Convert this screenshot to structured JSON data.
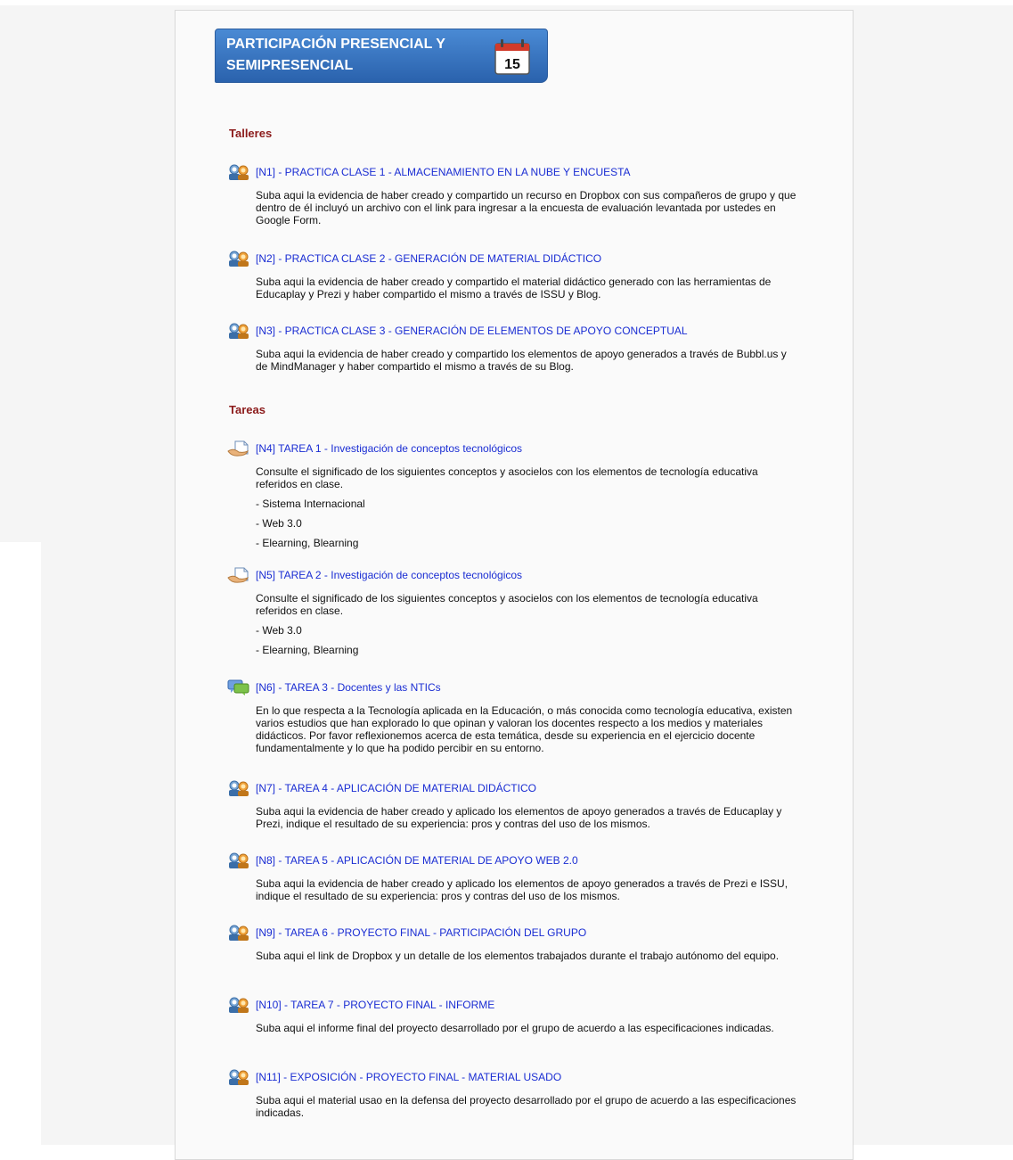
{
  "banner": {
    "title": "PARTICIPACIÓN PRESENCIAL Y SEMIPRESENCIAL",
    "calendar_day": "15"
  },
  "sections": {
    "talleres": "Talleres",
    "tareas": "Tareas"
  },
  "activities": [
    {
      "icon": "workshop-icon",
      "title": "[N1] - PRACTICA CLASE 1 - ALMACENAMIENTO EN LA NUBE Y ENCUESTA",
      "desc": "Suba aqui la evidencia de haber creado y compartido un recurso en Dropbox con sus compañeros de grupo y que dentro de él incluyó un archivo con el link para ingresar a la encuesta de evaluación levantada por ustedes en Google Form.",
      "items": []
    },
    {
      "icon": "workshop-icon",
      "title": "[N2] - PRACTICA CLASE 2 - GENERACIÓN DE MATERIAL DIDÁCTICO",
      "desc": "Suba aqui la evidencia de haber creado y compartido el material didáctico generado con las herramientas de Educaplay y Prezi y haber compartido el mismo a través de ISSU y Blog.",
      "items": []
    },
    {
      "icon": "workshop-icon",
      "title": "[N3] - PRACTICA CLASE 3 - GENERACIÓN DE ELEMENTOS DE APOYO CONCEPTUAL",
      "desc": "Suba aqui la evidencia de haber creado y compartido los elementos de apoyo generados a través de Bubbl.us y de MindManager y haber compartido el mismo a través de su Blog.",
      "items": []
    },
    {
      "icon": "assignment-icon",
      "title": "[N4] TAREA 1 - Investigación de conceptos tecnológicos",
      "desc": "Consulte el significado de los siguientes conceptos y asocielos con los elementos de tecnología educativa referidos en clase.",
      "items": [
        "- Sistema Internacional",
        "- Web 3.0",
        "- Elearning, Blearning"
      ]
    },
    {
      "icon": "assignment-icon",
      "title": "[N5] TAREA 2 - Investigación de conceptos tecnológicos",
      "desc": "Consulte el significado de los siguientes conceptos y asocielos con los elementos de tecnología educativa referidos en clase.",
      "items": [
        "- Web 3.0",
        "- Elearning, Blearning"
      ]
    },
    {
      "icon": "forum-icon",
      "title": "[N6] - TAREA 3 - Docentes y las NTICs",
      "desc": "En lo que respecta a la Tecnología aplicada en la Educación, o más conocida como tecnología educativa, existen varios estudios que han explorado lo que opinan y valoran los docentes respecto a los medios y materiales didácticos. Por favor reflexionemos acerca de esta temática, desde su experiencia en el ejercicio docente fundamentalmente y lo que ha podido percibir en su entorno.",
      "items": []
    },
    {
      "icon": "workshop-icon",
      "title": "[N7] - TAREA 4 - APLICACIÓN DE MATERIAL DIDÁCTICO",
      "desc": "Suba aqui la evidencia de haber creado y aplicado los elementos de apoyo generados a través de Educaplay y Prezi, indique el resultado de su experiencia: pros y contras del uso de los mismos.",
      "items": []
    },
    {
      "icon": "workshop-icon",
      "title": "[N8] - TAREA 5 - APLICACIÓN DE MATERIAL DE APOYO WEB 2.0",
      "desc": "Suba aqui la evidencia de haber creado y aplicado los elementos de apoyo generados a través de Prezi e ISSU, indique el resultado de su experiencia: pros y contras del uso de los mismos.",
      "items": []
    },
    {
      "icon": "workshop-icon",
      "title": "[N9] - TAREA 6 - PROYECTO FINAL - PARTICIPACIÓN DEL GRUPO",
      "desc": "Suba aqui el link de Dropbox y un detalle de los elementos trabajados durante el trabajo autónomo del equipo.",
      "items": []
    },
    {
      "icon": "workshop-icon",
      "title": "[N10] - TAREA 7 - PROYECTO FINAL - INFORME",
      "desc": "Suba aqui el informe final del proyecto desarrollado por el grupo de acuerdo a las especificaciones indicadas.",
      "items": []
    },
    {
      "icon": "workshop-icon",
      "title": "[N11] - EXPOSICIÓN - PROYECTO FINAL - MATERIAL USADO",
      "desc": "Suba aqui el material usao en la defensa del proyecto desarrollado por el grupo de acuerdo a las especificaciones indicadas.",
      "items": []
    }
  ]
}
